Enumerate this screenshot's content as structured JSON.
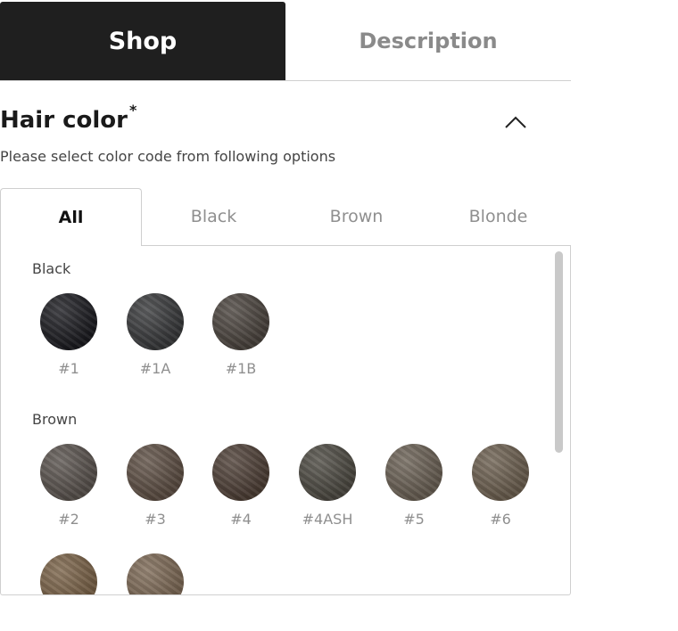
{
  "tabs": {
    "shop": "Shop",
    "description": "Description"
  },
  "hair_color": {
    "title": "Hair color",
    "required_mark": "*",
    "subtitle": "Please select color code from following options"
  },
  "filters": [
    "All",
    "Black",
    "Brown",
    "Blonde"
  ],
  "groups": {
    "black": {
      "label": "Black",
      "swatches": [
        {
          "code": "#1",
          "color": "#1b1b20"
        },
        {
          "code": "#1A",
          "color": "#38393b"
        },
        {
          "code": "#1B",
          "color": "#4b443e"
        }
      ]
    },
    "brown": {
      "label": "Brown",
      "swatches": [
        {
          "code": "#2",
          "color": "#5a534e"
        },
        {
          "code": "#3",
          "color": "#5e4f44"
        },
        {
          "code": "#4",
          "color": "#4e3f36"
        },
        {
          "code": "#4ASH",
          "color": "#4d4a42"
        },
        {
          "code": "#5",
          "color": "#6b6155"
        },
        {
          "code": "#6",
          "color": "#6d6050"
        },
        {
          "code": "",
          "color": "#7a6247"
        },
        {
          "code": "",
          "color": "#7d6955"
        }
      ]
    }
  }
}
